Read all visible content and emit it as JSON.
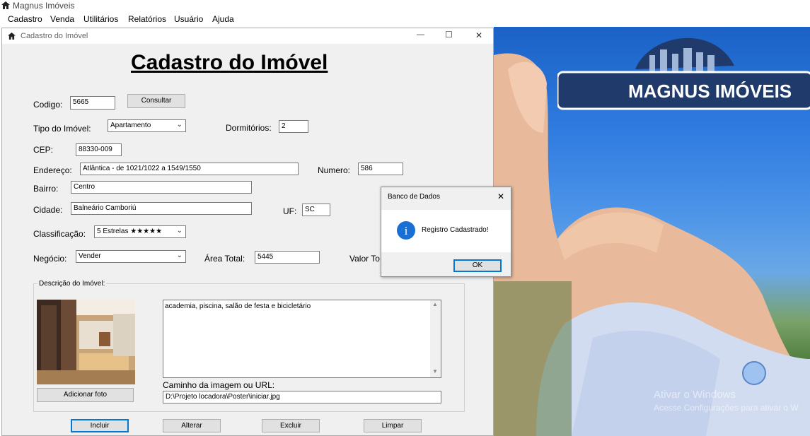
{
  "app": {
    "title": "Magnus Imóveis",
    "menu": [
      "Cadastro",
      "Venda",
      "Utilitários",
      "Relatórios",
      "Usuário",
      "Ajuda"
    ]
  },
  "window": {
    "title": "Cadastro do Imóvel",
    "heading": "Cadastro do Imóvel",
    "controls": {
      "minimize": "—",
      "maximize": "☐",
      "close": "✕"
    }
  },
  "form": {
    "codigo": {
      "label": "Codigo:",
      "value": "5665"
    },
    "consultar_button": "Consultar",
    "tipo": {
      "label": "Tipo do Imóvel:",
      "value": "Apartamento"
    },
    "dormitorios": {
      "label": "Dormitórios:",
      "value": "2"
    },
    "cep": {
      "label": "CEP:",
      "value": "88330-009"
    },
    "endereco": {
      "label": "Endereço:",
      "value": "Atlântica - de 1021/1022 a 1549/1550"
    },
    "numero": {
      "label": "Numero:",
      "value": "586"
    },
    "bairro": {
      "label": "Bairro:",
      "value": "Centro"
    },
    "cidade": {
      "label": "Cidade:",
      "value": "Balneário Camboriú"
    },
    "uf": {
      "label": "UF:",
      "value": "SC"
    },
    "classificacao": {
      "label": "Classificação:",
      "value": "5 Estrelas ★★★★★"
    },
    "negocio": {
      "label": "Negócio:",
      "value": "Vender"
    },
    "area_total": {
      "label": "Área Total:",
      "value": "5445"
    },
    "valor_total": {
      "label": "Valor To"
    },
    "descricao": {
      "group_label": "Descrição do Imóvel:",
      "text": "academia, piscina, salão de festa e bicicletário",
      "add_photo_button": "Adicionar foto",
      "path_label": "Caminho da imagem ou URL:",
      "path_value": "D:\\Projeto locadora\\Poster\\iniciar.jpg"
    },
    "buttons": {
      "incluir": "Incluir",
      "alterar": "Alterar",
      "excluir": "Excluir",
      "limpar": "Limpar"
    }
  },
  "dialog": {
    "title": "Banco de Dados",
    "close": "✕",
    "message": "Registro Cadastrado!",
    "ok": "OK",
    "icon": "info-icon"
  },
  "desktop": {
    "logo_text": "MAGNUS IMÓVEIS",
    "watermark_line1": "Ativar o Windows",
    "watermark_line2": "Acesse Configurações para ativar o W"
  },
  "colors": {
    "accent": "#0078d7",
    "logo_navy": "#1f3a6b",
    "info_blue": "#1a6fd4"
  }
}
